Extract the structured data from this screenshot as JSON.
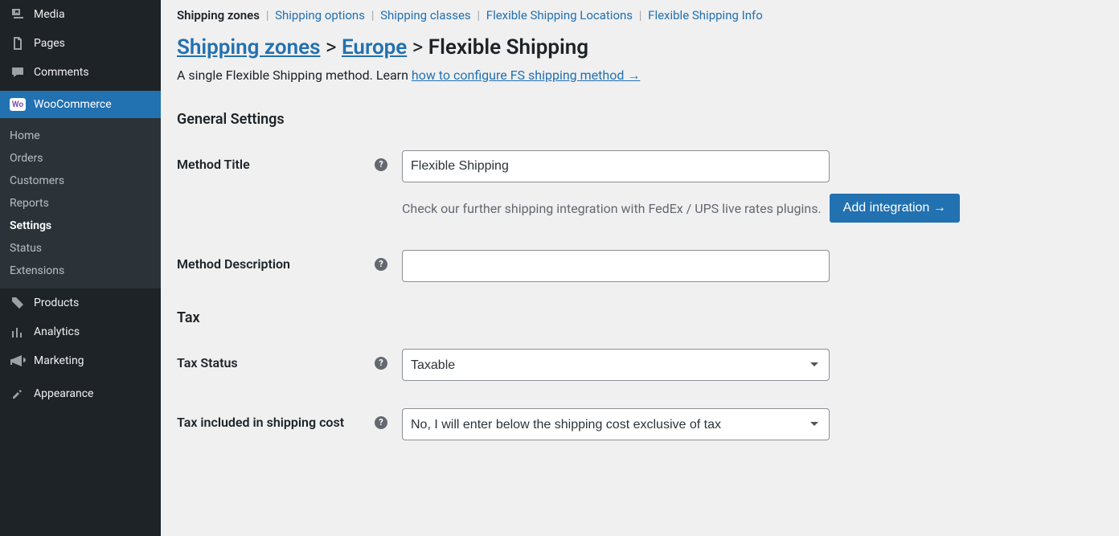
{
  "sidebar": {
    "items": [
      {
        "label": "Media",
        "icon": "media"
      },
      {
        "label": "Pages",
        "icon": "page"
      },
      {
        "label": "Comments",
        "icon": "comment"
      },
      {
        "label": "WooCommerce",
        "icon": "woo",
        "current": true
      },
      {
        "label": "Products",
        "icon": "product"
      },
      {
        "label": "Analytics",
        "icon": "analytics"
      },
      {
        "label": "Marketing",
        "icon": "marketing"
      },
      {
        "label": "Appearance",
        "icon": "appearance"
      }
    ],
    "sub": {
      "home": "Home",
      "orders": "Orders",
      "customers": "Customers",
      "reports": "Reports",
      "settings": "Settings",
      "status": "Status",
      "extensions": "Extensions"
    }
  },
  "tabs": {
    "zones": "Shipping zones",
    "options": "Shipping options",
    "classes": "Shipping classes",
    "locations": "Flexible Shipping Locations",
    "info": "Flexible Shipping Info"
  },
  "breadcrumb": {
    "zones": "Shipping zones",
    "zone": "Europe",
    "method": "Flexible Shipping",
    "sep": ">"
  },
  "intro": {
    "text": "A single Flexible Shipping method. Learn ",
    "link": "how to configure FS shipping method →"
  },
  "sections": {
    "general": "General Settings",
    "tax": "Tax"
  },
  "fields": {
    "method_title": {
      "label": "Method Title",
      "value": "Flexible Shipping"
    },
    "method_description": {
      "label": "Method Description",
      "value": ""
    },
    "tax_status": {
      "label": "Tax Status",
      "value": "Taxable"
    },
    "tax_included": {
      "label": "Tax included in shipping cost",
      "value": "No, I will enter below the shipping cost exclusive of tax"
    }
  },
  "integration": {
    "hint": "Check our further shipping integration with FedEx / UPS live rates plugins.",
    "button": "Add integration →"
  }
}
